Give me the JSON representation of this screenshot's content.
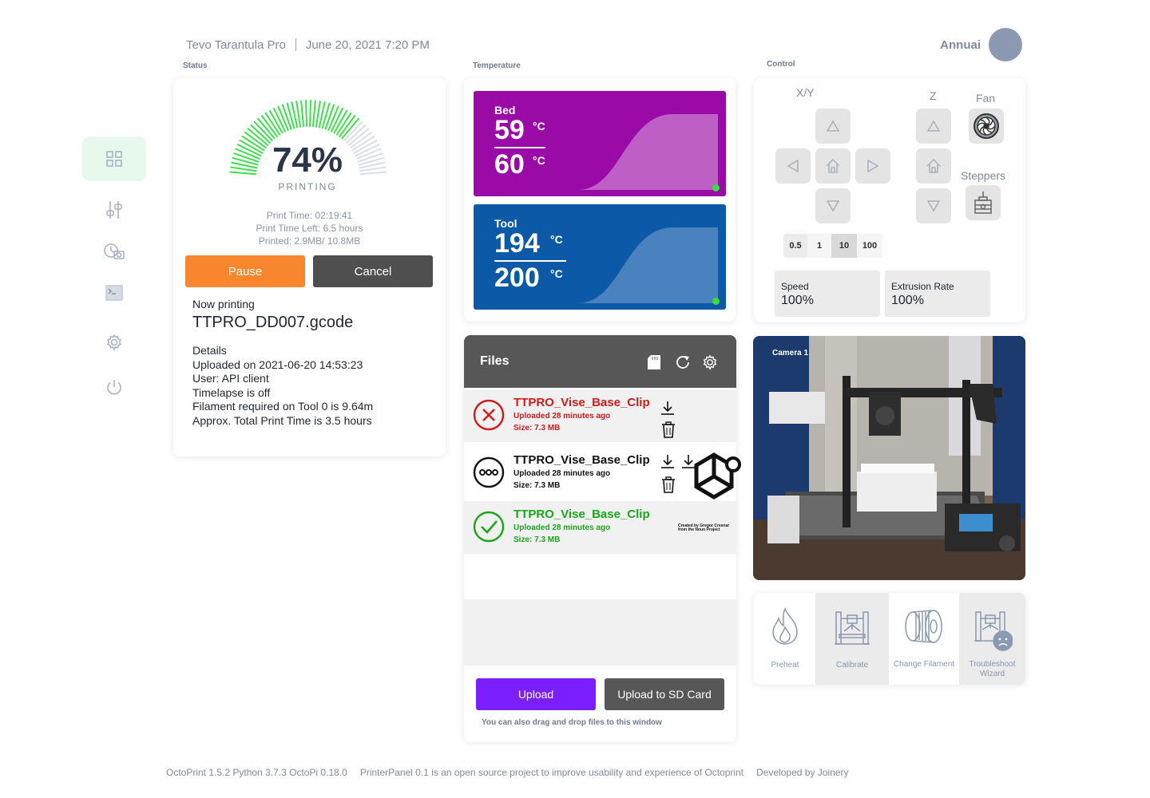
{
  "header": {
    "printer_name": "Tevo Tarantula Pro",
    "datetime": "June 20, 2021 7:20 PM",
    "user_name": "Annuai"
  },
  "sections": {
    "status": "Status",
    "temperature": "Temperature",
    "control": "Control"
  },
  "sidebar": {
    "items": [
      {
        "icon": "dashboard-grid-icon",
        "active": true
      },
      {
        "icon": "sliders-icon",
        "active": false
      },
      {
        "icon": "timelapse-camera-icon",
        "active": false
      },
      {
        "icon": "terminal-icon",
        "active": false
      },
      {
        "icon": "gear-icon",
        "active": false
      },
      {
        "icon": "power-icon",
        "active": false
      }
    ]
  },
  "status": {
    "progress_percent": 74,
    "progress_label": "74%",
    "state": "PRINTING",
    "print_time": "Print Time: 02:19:41",
    "print_time_left": "Print Time Left: 6.5 hours",
    "printed": "Printed: 2.9MB/ 10.8MB",
    "pause_label": "Pause",
    "cancel_label": "Cancel",
    "now_printing_label": "Now printing",
    "file_name": "TTPRO_DD007.gcode",
    "details_label": "Details",
    "details": [
      "Uploaded on 2021-06-20 14:53:23",
      "User: API client",
      "Timelapse is off",
      "Filament required on Tool 0 is 9.64m",
      "Approx. Total Print Time is 3.5 hours"
    ]
  },
  "temperature": {
    "bed": {
      "name": "Bed",
      "actual": "59",
      "target": "60",
      "unit": "°C",
      "color": "#9a0aa6"
    },
    "tool": {
      "name": "Tool",
      "actual": "194",
      "target": "200",
      "unit": "°C",
      "color": "#0c59a8"
    },
    "status_dot_color": "#37e03f"
  },
  "control": {
    "xy_label": "X/Y",
    "z_label": "Z",
    "fan_label": "Fan",
    "steppers_label": "Steppers",
    "step_sizes": [
      "0.5",
      "1",
      "10",
      "100"
    ],
    "selected_step": "10",
    "speed_label": "Speed",
    "speed_value": "100%",
    "extrusion_label": "Extrusion Rate",
    "extrusion_value": "100%"
  },
  "files": {
    "title": "Files",
    "items": [
      {
        "name": "TTPRO_Vise_Base_Clip",
        "uploaded": "Uploaded 28 minutes ago",
        "size": "Size: 7.3 MB",
        "status": "failed",
        "color": "#d11a1a"
      },
      {
        "name": "TTPRO_Vise_Base_Clip",
        "uploaded": "Uploaded 28 minutes ago",
        "size": "Size: 7.3 MB",
        "status": "pending",
        "color": "#111111"
      },
      {
        "name": "TTPRO_Vise_Base_Clip",
        "uploaded": "Uploaded 28 minutes ago",
        "size": "Size: 7.3 MB",
        "status": "success",
        "color": "#1aa51a"
      }
    ],
    "credit": "Created by Gregor Cresnar from the Noun Project",
    "upload_label": "Upload",
    "upload_sd_label": "Upload to SD Card",
    "drag_hint": "You can also drag and drop files to this window"
  },
  "camera": {
    "label": "Camera 1"
  },
  "tools": [
    {
      "label": "Preheat",
      "icon": "flame-icon"
    },
    {
      "label": "Calibrate",
      "icon": "calibrate-printer-icon"
    },
    {
      "label": "Change Filament",
      "icon": "filament-spool-icon"
    },
    {
      "label": "Troubleshoot Wizard",
      "icon": "troubleshoot-printer-icon"
    }
  ],
  "footer": {
    "versions": "OctoPrint 1.5.2 Python 3.7.3 OctoPi 0.18.0",
    "about": "PrinterPanel 0.1  is an open source project to improve usability and experience of Octoprint",
    "developer": "Developed by Joinery"
  }
}
